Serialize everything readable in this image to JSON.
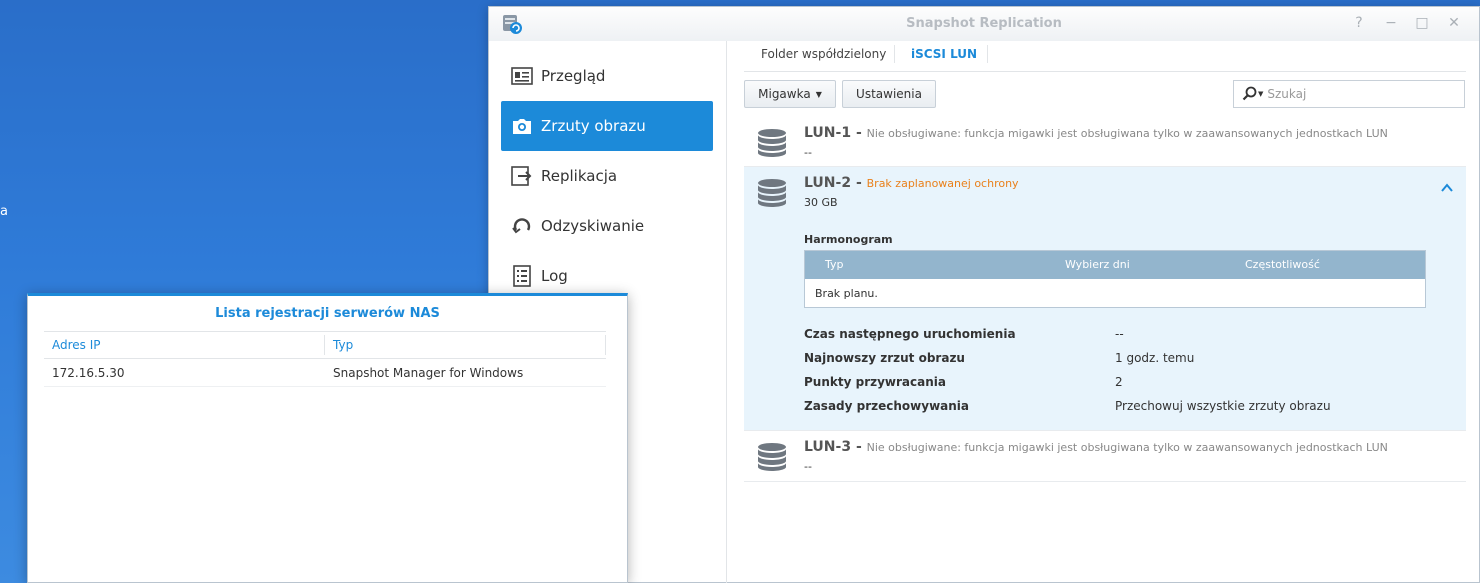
{
  "window": {
    "title": "Snapshot Replication",
    "help": "?",
    "minimize": "−",
    "maximize": "□",
    "close": "✕"
  },
  "desktop": {
    "icon_label": "a"
  },
  "sidebar": {
    "items": [
      {
        "label": "Przegląd",
        "icon": "overview-icon"
      },
      {
        "label": "Zrzuty obrazu",
        "icon": "camera-icon"
      },
      {
        "label": "Replikacja",
        "icon": "replication-icon"
      },
      {
        "label": "Odzyskiwanie",
        "icon": "recovery-icon"
      },
      {
        "label": "Log",
        "icon": "log-icon"
      }
    ],
    "active_index": 1
  },
  "tabs": [
    {
      "label": "Folder współdzielony"
    },
    {
      "label": "iSCSI LUN"
    }
  ],
  "toolbar": {
    "snapshot_label": "Migawka",
    "settings_label": "Ustawienia",
    "search_placeholder": "Szukaj"
  },
  "luns": [
    {
      "name": "LUN-1",
      "sep": "-",
      "status": "Nie obsługiwane: funkcja migawki jest obsługiwana tylko w zaawansowanych jednostkach LUN",
      "sub": "--"
    },
    {
      "name": "LUN-2",
      "sep": "-",
      "status": "Brak zaplanowanej ochrony",
      "sub": "30 GB",
      "schedule_title": "Harmonogram",
      "schedule_columns": [
        "Typ",
        "Wybierz dni",
        "Częstotliwość"
      ],
      "schedule_empty": "Brak planu.",
      "properties": [
        {
          "label": "Czas następnego uruchomienia",
          "value": "--"
        },
        {
          "label": "Najnowszy zrzut obrazu",
          "value": "1 godz. temu"
        },
        {
          "label": "Punkty przywracania",
          "value": "2"
        },
        {
          "label": "Zasady przechowywania",
          "value": "Przechowuj wszystkie zrzuty obrazu"
        }
      ]
    },
    {
      "name": "LUN-3",
      "sep": "-",
      "status": "Nie obsługiwane: funkcja migawki jest obsługiwana tylko w zaawansowanych jednostkach LUN",
      "sub": "--"
    }
  ],
  "nas_dialog": {
    "title": "Lista rejestracji serwerów NAS",
    "columns": [
      "Adres IP",
      "Typ"
    ],
    "rows": [
      {
        "ip": "172.16.5.30",
        "type": "Snapshot Manager for Windows"
      }
    ]
  },
  "colors": {
    "accent": "#1c8ad9",
    "warning": "#e9801b",
    "table_header": "#93b5cd",
    "expanded_bg": "#e8f4fc"
  }
}
